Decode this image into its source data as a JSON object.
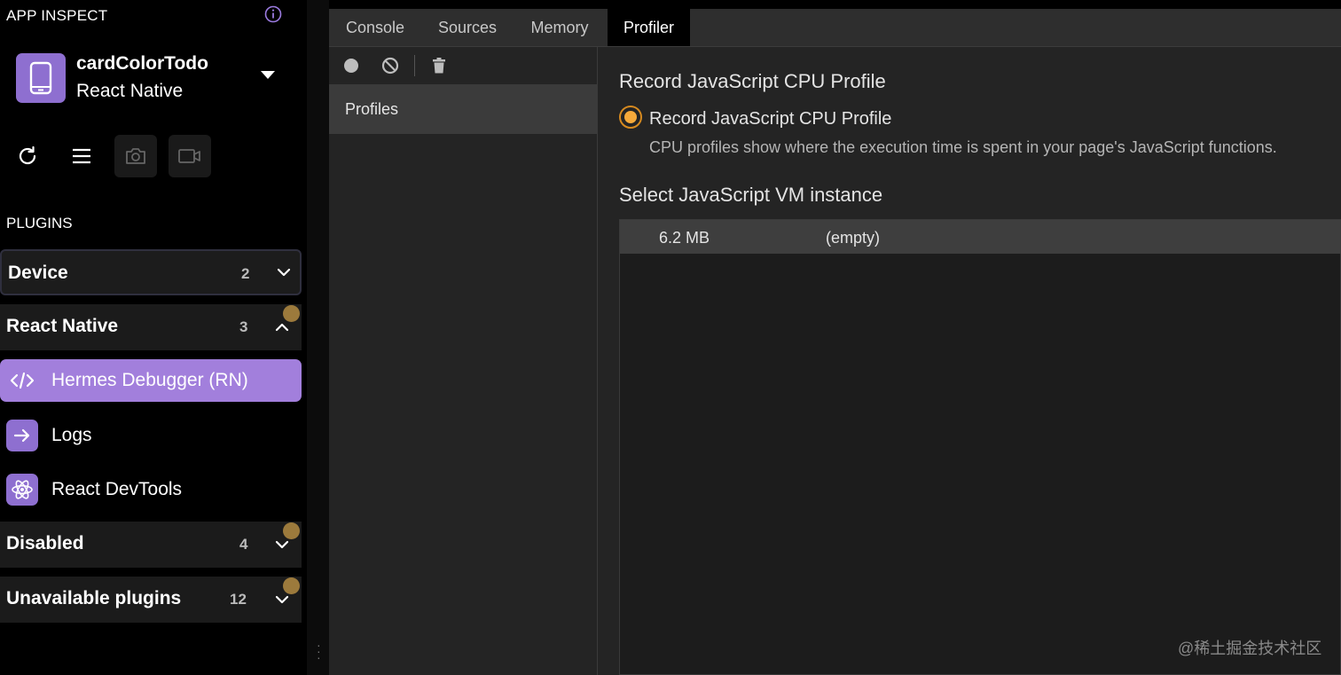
{
  "sidebar": {
    "title": "APP INSPECT",
    "app": {
      "name": "cardColorTodo",
      "platform": "React Native"
    },
    "plugins_heading": "PLUGINS",
    "sections": [
      {
        "label": "Device",
        "count": "2",
        "expanded": false,
        "has_badge": false
      },
      {
        "label": "React Native",
        "count": "3",
        "expanded": true,
        "has_badge": true
      },
      {
        "label": "Disabled",
        "count": "4",
        "expanded": false,
        "has_badge": true
      },
      {
        "label": "Unavailable plugins",
        "count": "12",
        "expanded": false,
        "has_badge": true
      }
    ],
    "items": [
      {
        "label": "Hermes Debugger (RN)",
        "icon": "code-icon",
        "active": true
      },
      {
        "label": "Logs",
        "icon": "arrow-right-icon",
        "active": false
      },
      {
        "label": "React DevTools",
        "icon": "react-atom-icon",
        "active": false
      }
    ],
    "toolbar_icons": [
      "reload-icon",
      "menu-icon",
      "camera-icon",
      "video-icon"
    ]
  },
  "tabs": [
    {
      "label": "Console",
      "active": false
    },
    {
      "label": "Sources",
      "active": false
    },
    {
      "label": "Memory",
      "active": false
    },
    {
      "label": "Profiler",
      "active": true
    }
  ],
  "profiler": {
    "toolbar_icons": [
      "record-icon",
      "clear-icon",
      "trash-icon"
    ],
    "left_list_label": "Profiles",
    "heading_record": "Record JavaScript CPU Profile",
    "radio_label": "Record JavaScript CPU Profile",
    "radio_description": "CPU profiles show where the execution time is spent in your page's JavaScript functions.",
    "heading_select": "Select JavaScript VM instance",
    "vm_instances": [
      {
        "size": "6.2 MB",
        "name": "(empty)"
      }
    ]
  },
  "watermark": "@稀土掘金技术社区",
  "colors": {
    "accent_purple": "#a27fdc",
    "icon_purple": "#8e6fd0",
    "badge_gold": "#9c7a3c",
    "radio_orange": "#f5a93a"
  }
}
